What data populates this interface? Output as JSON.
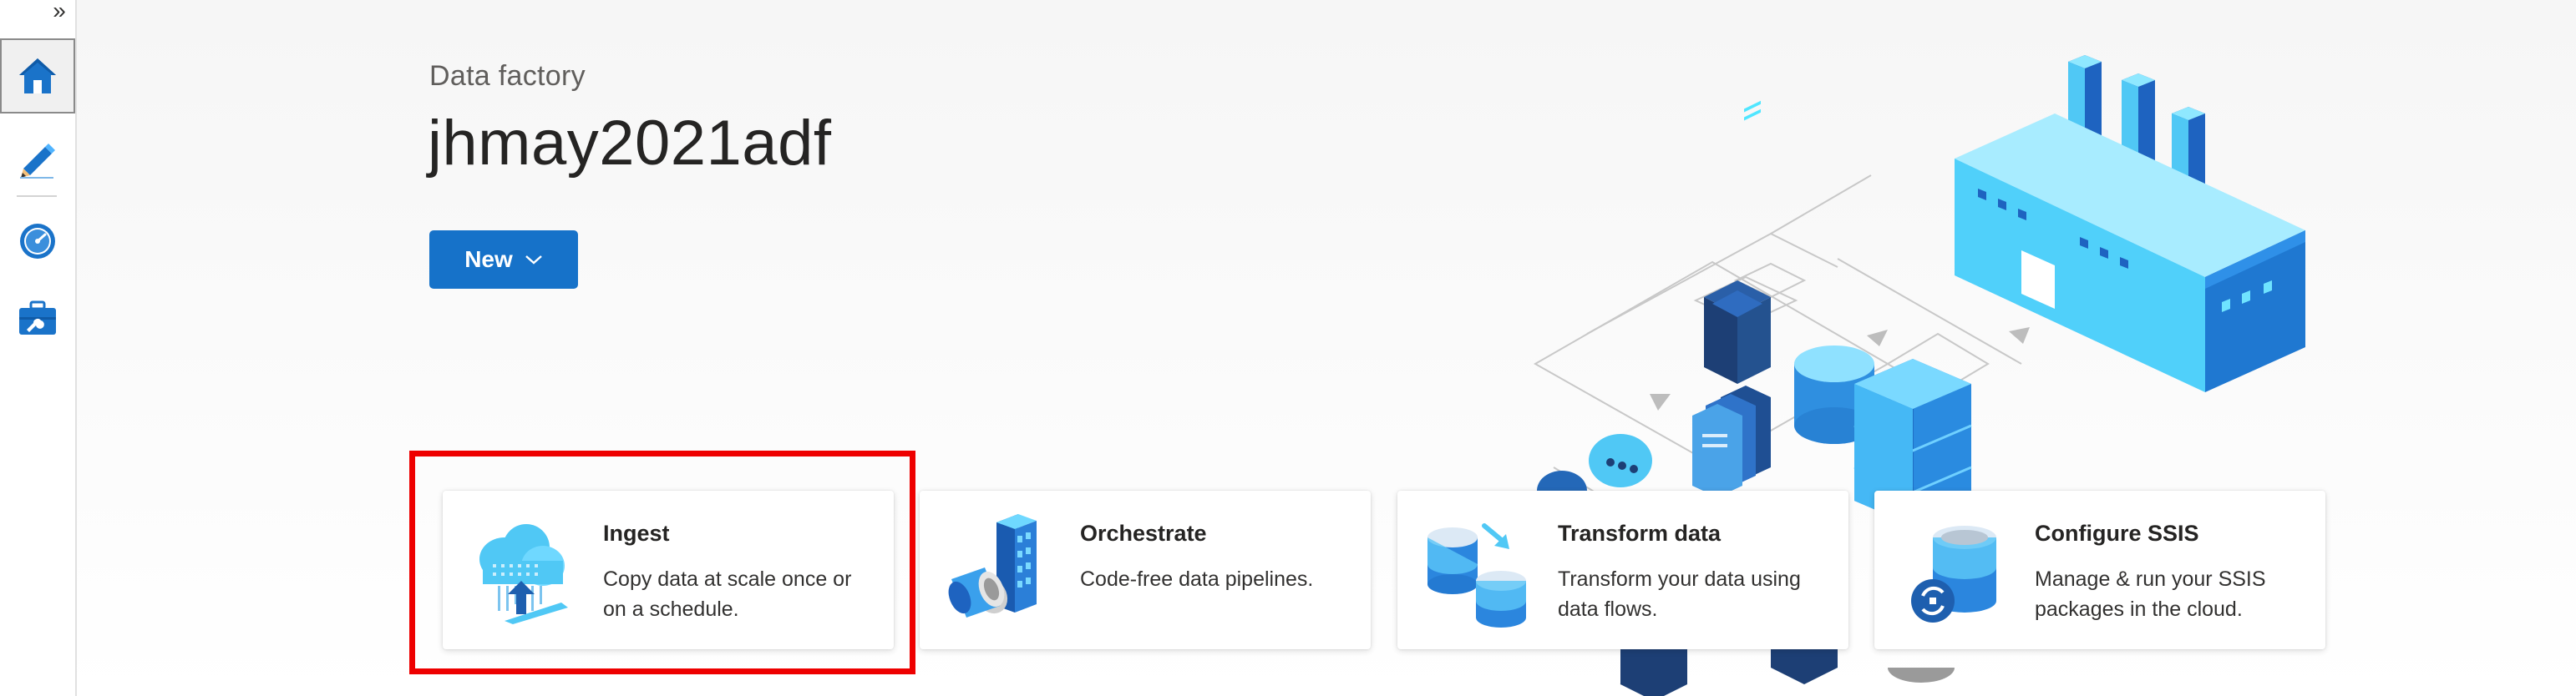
{
  "sidebar": {
    "expand_glyph": "»",
    "items": [
      {
        "name": "home-icon",
        "active": true
      },
      {
        "name": "author-pencil-icon",
        "active": false
      },
      {
        "name": "monitor-gauge-icon",
        "active": false
      },
      {
        "name": "manage-toolbox-icon",
        "active": false
      }
    ]
  },
  "header": {
    "subtitle": "Data factory",
    "title": "jhmay2021adf",
    "new_button_label": "New"
  },
  "cards": [
    {
      "title": "Ingest",
      "description": "Copy data at scale once or on a schedule.",
      "icon": "ingest-cloud-icon"
    },
    {
      "title": "Orchestrate",
      "description": "Code-free data pipelines.",
      "icon": "orchestrate-icon"
    },
    {
      "title": "Transform data",
      "description": "Transform your data using data flows.",
      "icon": "transform-icon"
    },
    {
      "title": "Configure SSIS",
      "description": "Manage & run your SSIS packages in the cloud.",
      "icon": "ssis-icon"
    }
  ],
  "colors": {
    "accent": "#1672c9",
    "highlight": "#ee0000",
    "icon_blue": "#0f6cbd",
    "icon_light": "#50e6ff"
  }
}
